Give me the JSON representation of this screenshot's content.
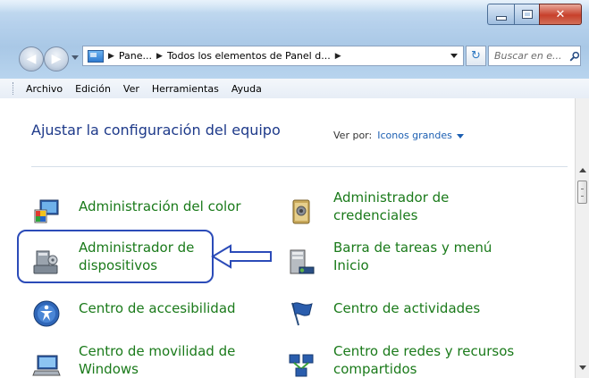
{
  "window": {
    "buttons": {
      "minimize": "minimize",
      "maximize": "maximize",
      "close": "close"
    }
  },
  "address_bar": {
    "crumbs": [
      "Pane...",
      "Todos los elementos de Panel d..."
    ],
    "search_placeholder": "Buscar en e..."
  },
  "menu": {
    "items": [
      "Archivo",
      "Edición",
      "Ver",
      "Herramientas",
      "Ayuda"
    ]
  },
  "content": {
    "title": "Ajustar la configuración del equipo",
    "view_by_label": "Ver por:",
    "view_by_value": "Iconos grandes"
  },
  "items": [
    {
      "label": "Administración del color",
      "icon": "color-management-icon"
    },
    {
      "label": "Administrador de\ncredenciales",
      "icon": "credential-manager-icon"
    },
    {
      "label": "Administrador de\ndispositivos",
      "icon": "device-manager-icon"
    },
    {
      "label": "Barra de tareas y menú\nInicio",
      "icon": "taskbar-icon"
    },
    {
      "label": "Centro de accesibilidad",
      "icon": "accessibility-icon"
    },
    {
      "label": "Centro de actividades",
      "icon": "action-center-flag-icon"
    },
    {
      "label": "Centro de movilidad de\nWindows",
      "icon": "mobility-center-icon"
    },
    {
      "label": "Centro de redes y recursos\ncompartidos",
      "icon": "network-center-icon"
    }
  ],
  "colors": {
    "link_green": "#1a7a1a",
    "header_blue": "#1e3a8a",
    "annotation_blue": "#2b4bb8"
  }
}
